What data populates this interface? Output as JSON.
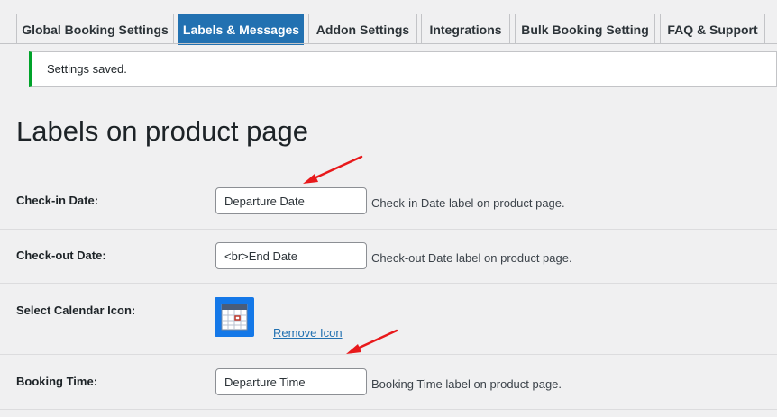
{
  "tabs": [
    {
      "label": "Global Booking Settings",
      "active": false
    },
    {
      "label": "Labels & Messages",
      "active": true
    },
    {
      "label": "Addon Settings",
      "active": false
    },
    {
      "label": "Integrations",
      "active": false
    },
    {
      "label": "Bulk Booking Setting",
      "active": false
    },
    {
      "label": "FAQ & Support",
      "active": false
    }
  ],
  "notice": {
    "text": "Settings saved.",
    "color": "#00a32a"
  },
  "page_title": "Labels on product page",
  "fields": {
    "checkin": {
      "label": "Check-in Date:",
      "value": "Departure Date",
      "description": "Check-in Date label on product page."
    },
    "checkout": {
      "label": "Check-out Date:",
      "value": "<br>End Date",
      "description": "Check-out Date label on product page."
    },
    "calendar_icon": {
      "label": "Select Calendar Icon:",
      "icon": "calendar-icon",
      "remove_label": "Remove Icon"
    },
    "booking_time": {
      "label": "Booking Time:",
      "value": "Departure Time",
      "description": "Booking Time label on product page."
    }
  },
  "colors": {
    "accent": "#2271b1",
    "annotation_arrow": "#e8191b"
  }
}
